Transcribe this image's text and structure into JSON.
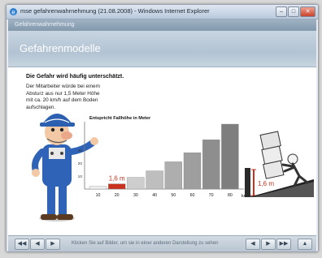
{
  "window": {
    "title": "mse gefahrenwahrnehmung (21.08.2008) - Windows Internet Explorer"
  },
  "module": {
    "label": "Gefahrenwahrnehmung"
  },
  "header": {
    "title": "Gefahrenmodelle"
  },
  "content": {
    "heading": "Die Gefahr wird häufig unterschätzt.",
    "description": "Der Mitarbeiter würde bei einem Absturz aus nur 1,5 Meter Höhe mit ca. 20 km/h auf dem Boden aufschlagen."
  },
  "chart_data": {
    "type": "bar",
    "title": "Entspricht Fallhöhe in Meter",
    "categories": [
      "10",
      "20",
      "30",
      "40",
      "50",
      "60",
      "70",
      "80"
    ],
    "values": [
      2,
      4,
      9,
      14,
      21,
      28,
      38,
      50
    ],
    "highlight_index": 1,
    "highlight_label": "1,6 m",
    "xunit": "km/h",
    "ylim": [
      0,
      50
    ],
    "yticks": [
      "10",
      "20",
      "30"
    ],
    "side_label": "1,6 m",
    "colors": {
      "bar_start": "#7e7e7e",
      "bar_end": "#eeeeee",
      "highlight": "#c8321e",
      "label": "#c8321e"
    }
  },
  "bottombar": {
    "status": "Klicken Sie auf Bilder, um sie in einer anderen Darstellung zu sehen",
    "left_buttons": [
      "◀◀",
      "◀",
      "▶"
    ],
    "right_buttons": [
      "◀",
      "▶",
      "▶▶",
      "▲"
    ]
  }
}
